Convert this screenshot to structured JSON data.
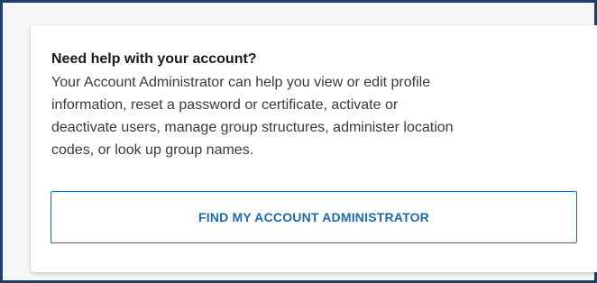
{
  "help_card": {
    "title": "Need help with your account?",
    "description_lines": [
      "Your Account Administrator can help you view or edit profile",
      "information, reset a password or certificate, activate or",
      "deactivate users, manage group structures, administer location",
      "codes, or look up group names."
    ],
    "button_label": "FIND MY ACCOUNT ADMINISTRATOR"
  },
  "colors": {
    "accent": "#1e6aa8",
    "frame_border": "#1f3f6a",
    "title_text": "#1a1a1a",
    "body_text": "#3a3a3a"
  }
}
